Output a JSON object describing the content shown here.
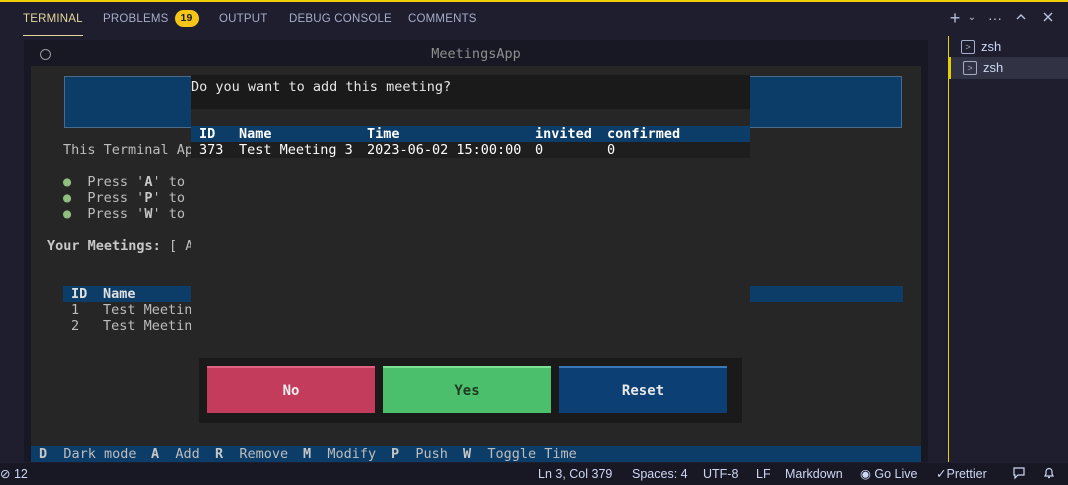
{
  "panel_tabs": [
    {
      "label": "TERMINAL"
    },
    {
      "label": "PROBLEMS"
    },
    {
      "label": "OUTPUT"
    },
    {
      "label": "DEBUG CONSOLE"
    },
    {
      "label": "COMMENTS"
    }
  ],
  "problems_count": "19",
  "toolbar_icons": [
    "add-icon",
    "chevron-down-icon",
    "more-icon",
    "chevron-up-icon",
    "close-icon"
  ],
  "terminals": [
    {
      "label": "zsh"
    },
    {
      "label": "zsh"
    }
  ],
  "app": {
    "title": "MeetingsApp",
    "intro": "This Terminal Ap",
    "bullets": [
      {
        "text_a": "Press '",
        "key": "A",
        "text_b": "' to"
      },
      {
        "text_a": "Press '",
        "key": "P",
        "text_b": "' to"
      },
      {
        "text_a": "Press '",
        "key": "W",
        "text_b": "' to"
      }
    ],
    "your_meetings_label": "Your Meetings:",
    "your_meetings_rest": "[ A",
    "table_headers": [
      "ID",
      "Name"
    ],
    "rows": [
      {
        "id": "1",
        "name": "Test Meetin"
      },
      {
        "id": "2",
        "name": "Test Meetin"
      }
    ],
    "footer": [
      {
        "key": "D",
        "label": "Dark mode"
      },
      {
        "key": "A",
        "label": "Add"
      },
      {
        "key": "R",
        "label": "Remove"
      },
      {
        "key": "M",
        "label": "Modify"
      },
      {
        "key": "P",
        "label": "Push"
      },
      {
        "key": "W",
        "label": "Toggle Time"
      }
    ]
  },
  "modal": {
    "question": "Do you want to add this meeting?",
    "headers": [
      "ID",
      "Name",
      "Time",
      "invited",
      "confirmed"
    ],
    "row": {
      "id": "373",
      "name": "Test Meeting 3",
      "time": "2023-06-02 15:00:00",
      "invited": "0",
      "confirmed": "0"
    },
    "buttons": {
      "no": "No",
      "yes": "Yes",
      "reset": "Reset"
    }
  },
  "statusbar": {
    "left": "12",
    "position": "Ln 3, Col 379",
    "spaces": "Spaces: 4",
    "encoding": "UTF-8",
    "eol": "LF",
    "language": "Markdown",
    "golive": "Go Live",
    "prettier": "Prettier"
  }
}
